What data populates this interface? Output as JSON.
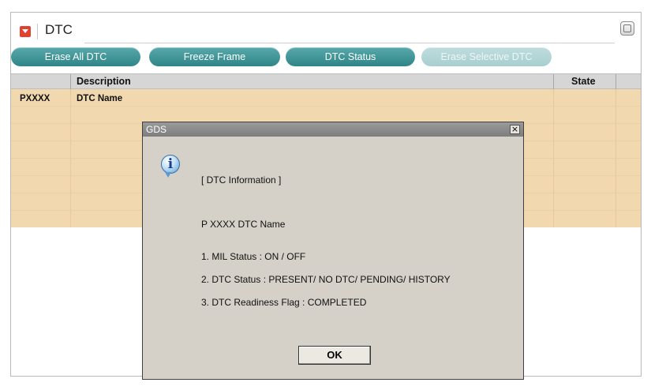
{
  "header": {
    "title": "DTC"
  },
  "toolbar": {
    "erase_all": "Erase All DTC",
    "freeze_frame": "Freeze Frame",
    "dtc_status": "DTC Status",
    "erase_selective": "Erase Selective DTC"
  },
  "table": {
    "columns": {
      "description": "Description",
      "state": "State"
    },
    "rows": [
      {
        "code": "PXXXX",
        "description": "DTC Name",
        "state": ""
      }
    ]
  },
  "dialog": {
    "title": "GDS",
    "close": "×",
    "heading": "[ DTC Information ]",
    "dtc_line": "P XXXX DTC Name",
    "mil_status": "1. MIL Status : ON / OFF",
    "dtc_status": "2. DTC Status : PRESENT/ NO DTC/ PENDING/ HISTORY",
    "readiness": "3. DTC Readiness Flag : COMPLETED",
    "ok": "OK"
  },
  "icons": {
    "collapse": "collapse-icon",
    "window": "window-icon",
    "info": "info-icon"
  },
  "colors": {
    "teal": "#2f8587",
    "row_bg": "#f1d8ae",
    "dialog_bg": "#d5d1c8",
    "title_bar": "#8a8a8a"
  }
}
